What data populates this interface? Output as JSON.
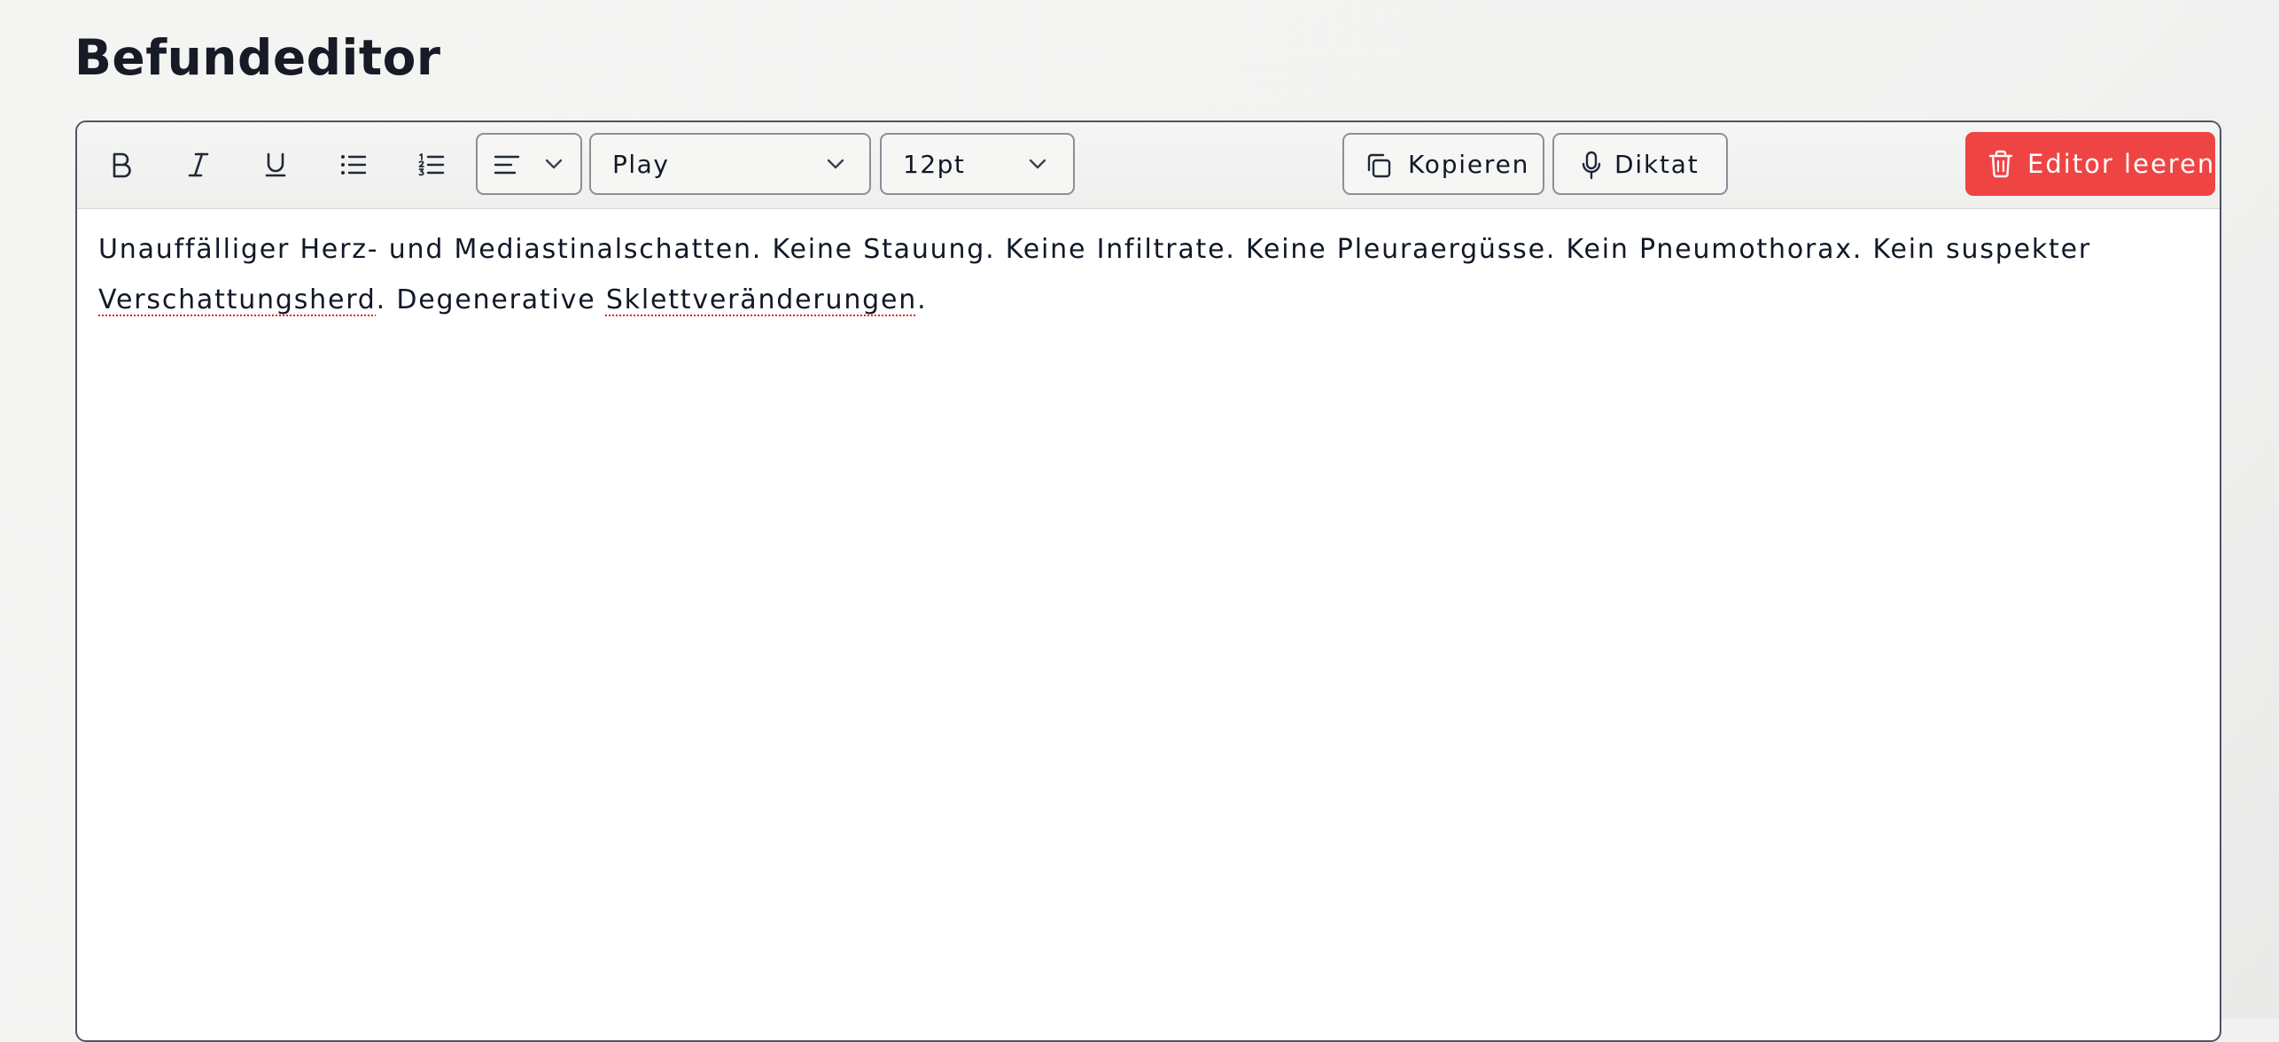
{
  "page": {
    "title": "Befundeditor"
  },
  "toolbar": {
    "format_buttons": [
      {
        "name": "bold",
        "icon": "bold-icon"
      },
      {
        "name": "italic",
        "icon": "italic-icon"
      },
      {
        "name": "underline",
        "icon": "underline-icon"
      },
      {
        "name": "bullet-list",
        "icon": "bullet-list-icon"
      },
      {
        "name": "numbered-list",
        "icon": "numbered-list-icon"
      }
    ],
    "align_select": {
      "icon": "align-left-icon"
    },
    "font_select": {
      "value": "Play"
    },
    "size_select": {
      "value": "12pt"
    },
    "copy_label": "Kopieren",
    "copy_icon": "copy-icon",
    "dictate_label": "Diktat",
    "dictate_icon": "microphone-icon",
    "clear_label": "Editor leeren",
    "clear_icon": "trash-icon"
  },
  "editor": {
    "segments": [
      {
        "text": "Unauffälliger Herz- und Mediastinalschatten. Keine Stauung. Keine Infiltrate. Keine Pleuraergüsse. Kein Pneumothorax. Kein suspekter ",
        "misspelled": false
      },
      {
        "text": "Verschattungsherd",
        "misspelled": true
      },
      {
        "text": ". Degenerative ",
        "misspelled": false
      },
      {
        "text": "Sklettveränderungen",
        "misspelled": true
      },
      {
        "text": ".",
        "misspelled": false
      }
    ]
  },
  "colors": {
    "danger": "#ef4444",
    "spellcheck_underline": "#dc2626",
    "title": "#161b26",
    "border": "#8a8f98"
  }
}
